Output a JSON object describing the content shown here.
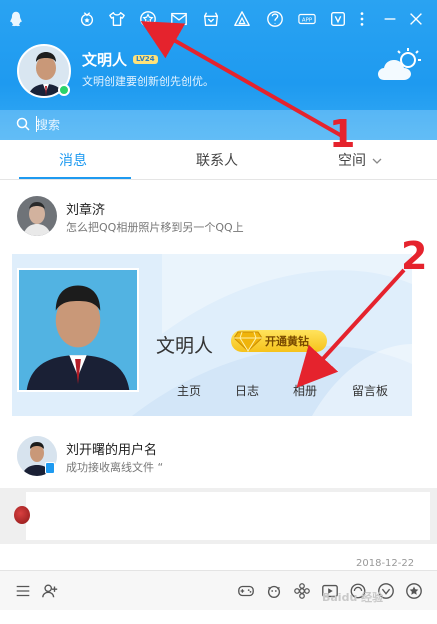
{
  "profile": {
    "nickname": "文明人",
    "level_badge": "LV24",
    "signature": "文明创建要创新创先创优。"
  },
  "search": {
    "placeholder": "搜索"
  },
  "tabs": [
    {
      "label": "消息",
      "active": true
    },
    {
      "label": "联系人",
      "active": false
    },
    {
      "label": "空间",
      "active": false
    }
  ],
  "chats": [
    {
      "name": "刘章济",
      "message": "怎么把QQ相册照片移到另一个QQ上"
    },
    {
      "name": "刘开曙的用户名",
      "message": "成功接收离线文件 “"
    }
  ],
  "card": {
    "name": "文明人",
    "yellow_button": "开通黄钻",
    "links": [
      "主页",
      "日志",
      "相册",
      "留言板"
    ]
  },
  "partial_date": "2018-12-22",
  "watermark": "Baidu 经验",
  "annotations": {
    "label_1": "1",
    "label_2": "2",
    "arrow_color": "#e5232d"
  },
  "colors": {
    "accent": "#1e9af0",
    "online": "#2bd36b"
  },
  "icons": {
    "topbar": [
      "qq-penguin-icon",
      "medal-icon",
      "tshirt-icon",
      "star-icon",
      "mail-icon",
      "shop-icon",
      "game-icon",
      "wallet-icon",
      "app-icon",
      "vip-icon",
      "more-icon",
      "minimize-icon",
      "close-icon"
    ],
    "bottombar": [
      "menu-icon",
      "add-contact-icon",
      "game-controller-icon",
      "pet-icon",
      "flower-icon",
      "video-icon",
      "group-icon",
      "heart-icon",
      "star-badge-icon"
    ]
  }
}
